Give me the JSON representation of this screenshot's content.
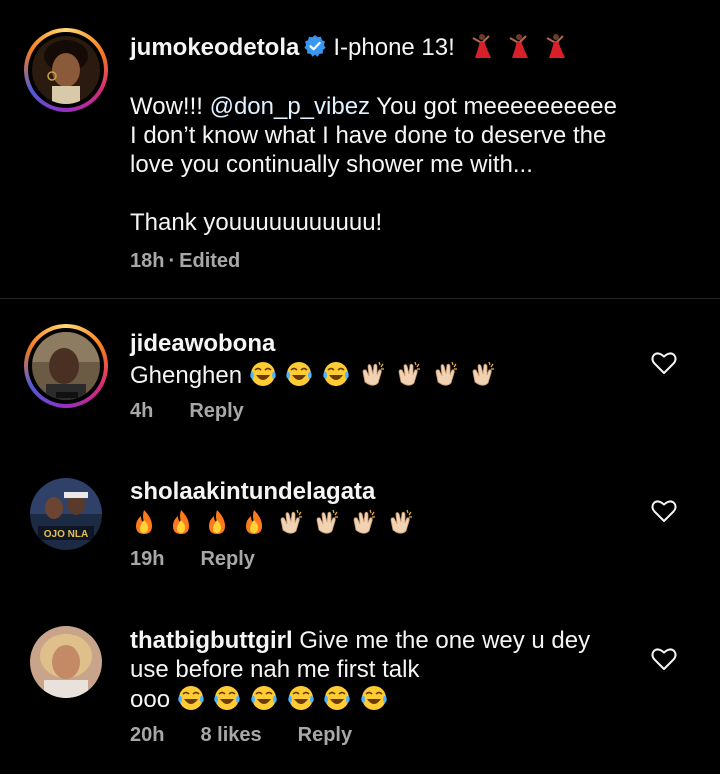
{
  "post": {
    "username": "jumokeodetola",
    "title": "I-phone 13!",
    "title_emojis": [
      "dancer",
      "dancer",
      "dancer"
    ],
    "line1_prefix": "Wow!!! ",
    "mention": "@don_p_vibez",
    "line1_suffix": " You got meeeeeeeeee",
    "line2": "I don’t know what I have done to deserve the",
    "line3": "love you continually shower me with...",
    "line4": "Thank youuuuuuuuuuu!",
    "time": "18h",
    "separator": "·",
    "edited": "Edited"
  },
  "comments": [
    {
      "username": "jideawobona",
      "text": "Ghenghen",
      "emojis": [
        "laughing-tears",
        "laughing-tears",
        "laughing-tears",
        "clap",
        "clap",
        "clap",
        "clap"
      ],
      "time": "4h",
      "likes": "",
      "reply": "Reply"
    },
    {
      "username": "sholaakintundelagata",
      "text": "",
      "emojis": [
        "fire",
        "fire",
        "fire",
        "fire",
        "clap",
        "clap",
        "clap",
        "clap"
      ],
      "time": "19h",
      "likes": "",
      "reply": "Reply",
      "avatar_caption": "OJO NLA"
    },
    {
      "username": "thatbigbuttgirl",
      "text_line1": "Give me the one wey u dey",
      "text_line2": "use before nah me first talk",
      "text_line3": "ooo",
      "emojis": [
        "laughing-tears",
        "laughing-tears",
        "laughing-tears",
        "laughing-tears",
        "laughing-tears",
        "laughing-tears"
      ],
      "time": "20h",
      "likes": "8 likes",
      "reply": "Reply"
    }
  ],
  "colors": {
    "background": "#000000",
    "text": "#f5f5f5",
    "muted": "#a8a8a8",
    "verified": "#3897f0",
    "divider": "#262626"
  }
}
